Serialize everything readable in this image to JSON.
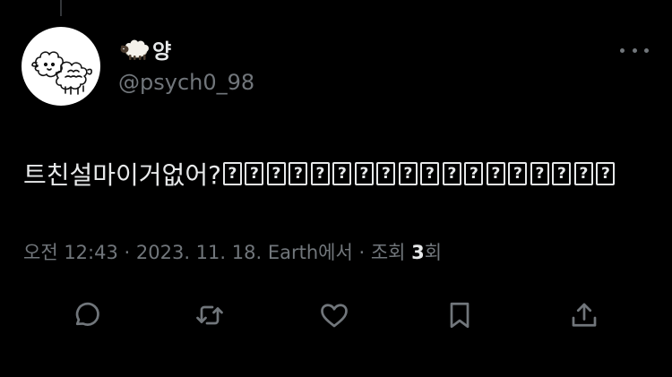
{
  "tweet": {
    "author": {
      "display_name": "양",
      "emoji_icon": "sheep-emoji",
      "handle": "@psych0_98",
      "avatar_icon": "fluffy-sheep-doodle"
    },
    "text": "트친설마이거없어?",
    "missing_glyphs": [
      "?",
      "?",
      "?",
      "?",
      "?",
      "?",
      "?",
      "?",
      "?",
      "?",
      "?",
      "?",
      "?",
      "?",
      "?",
      "?",
      "?",
      "?"
    ],
    "meta": {
      "time": "오전 12:43",
      "separator": " · ",
      "date": "2023. 11. 18.",
      "source": "Earth에서",
      "views_label": "조회",
      "views_count": "3",
      "views_unit": "회"
    },
    "actions": {
      "reply_icon": "speech-bubble-icon",
      "retweet_icon": "retweet-icon",
      "like_icon": "heart-icon",
      "bookmark_icon": "bookmark-icon",
      "share_icon": "share-icon",
      "more_icon": "more-dots-icon"
    }
  },
  "colors": {
    "background": "#000000",
    "primary_text": "#e7e9ea",
    "secondary_text": "#71767b",
    "thread_line": "#333639"
  }
}
